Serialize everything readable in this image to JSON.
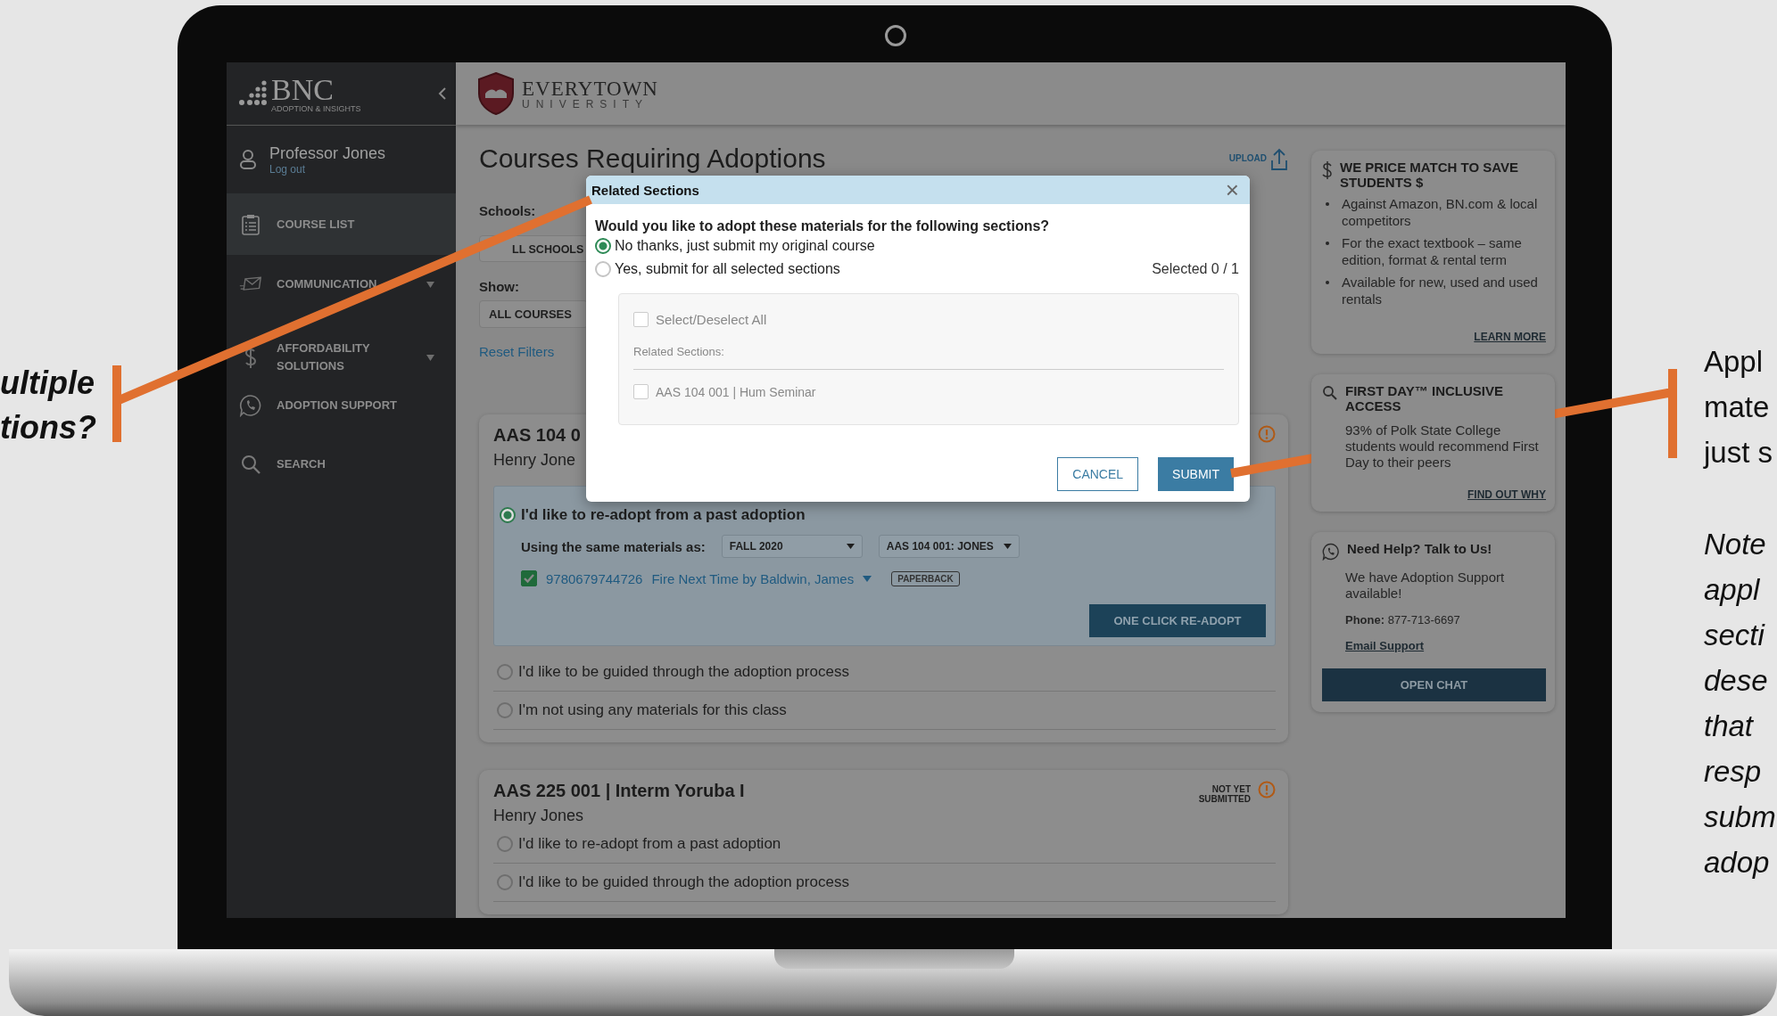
{
  "annotations": {
    "left_lines": [
      "ultiple",
      "tions?"
    ],
    "right_lines": [
      "Appl",
      "mate",
      "just s"
    ],
    "note_lines": [
      "Note",
      "appl",
      "secti",
      "dese",
      "that",
      "resp",
      "subm",
      "adop"
    ]
  },
  "sidebar": {
    "logo": "BNC",
    "logo_sub": "ADOPTION & INSIGHTS",
    "user": {
      "name": "Professor Jones",
      "link": "Log out"
    },
    "items": [
      {
        "label": "COURSE LIST",
        "selected": true,
        "expandable": false
      },
      {
        "label": "COMMUNICATION",
        "selected": false,
        "expandable": true
      },
      {
        "label": "AFFORDABILITY SOLUTIONS",
        "selected": false,
        "expandable": true
      },
      {
        "label": "ADOPTION SUPPORT",
        "selected": false,
        "expandable": false
      },
      {
        "label": "SEARCH",
        "selected": false,
        "expandable": false
      }
    ]
  },
  "header": {
    "school": "EVERYTOWN",
    "school_sub": "UNIVERSITY"
  },
  "page": {
    "title": "Courses Requiring Adoptions",
    "upload": "UPLOAD",
    "filters": [
      {
        "label": "Schools:",
        "value": "LL SCHOOLS"
      },
      {
        "label": "Show:",
        "value": "ALL COURSES"
      }
    ],
    "reset": "Reset Filters",
    "courses": [
      {
        "title": "AAS 104 0",
        "instructor": "Henry Jone",
        "options": [
          {
            "label": "I'd like to re-adopt from a past adoption",
            "selected": true,
            "details": {
              "materials_label": "Using the same materials as:",
              "term": "FALL 2020",
              "section": "AAS 104 001: JONES",
              "items": [
                {
                  "checked": true,
                  "isbn": "9780679744726",
                  "title": "Fire Next Time by Baldwin, James",
                  "format": "PAPERBACK"
                }
              ],
              "button": "ONE CLICK RE-ADOPT"
            }
          },
          {
            "label": "I'd like to be guided through the adoption process",
            "selected": false
          },
          {
            "label": "I'm not using any materials for this class",
            "selected": false
          }
        ]
      },
      {
        "title": "AAS 225 001 | Interm Yoruba I",
        "status": "NOT YET SUBMITTED",
        "instructor": "Henry Jones",
        "options": [
          {
            "label": "I'd like to re-adopt from a past adoption",
            "selected": false
          },
          {
            "label": "I'd like to be guided through the adoption process",
            "selected": false
          }
        ]
      }
    ]
  },
  "aside": [
    {
      "kind": "list",
      "title": "WE PRICE MATCH TO SAVE STUDENTS $",
      "bullets": [
        "Against Amazon, BN.com & local competitors",
        "For the exact textbook – same edition, format & rental term",
        "Available for new, used and used rentals"
      ],
      "link": "LEARN MORE"
    },
    {
      "kind": "text",
      "title": "FIRST DAY™ INCLUSIVE ACCESS",
      "text": "93% of Polk State College students would recommend First Day to their peers",
      "link": "FIND OUT WHY"
    },
    {
      "kind": "contact",
      "title": "Need Help? Talk to Us!",
      "text": "We have Adoption Support available!",
      "phone": "**Phone:** 877-713-6697",
      "link": "Email Support",
      "button": "OPEN CHAT"
    }
  ],
  "modal": {
    "title": "Related Sections",
    "close": "×",
    "question": "Would you like to adopt these materials for the following sections?",
    "choices": [
      {
        "label": "No thanks, just submit my original course",
        "selected": true
      },
      {
        "label": "Yes, submit for all selected sections",
        "selected": false
      }
    ],
    "selected_count": "Selected 0 / 1",
    "select_all": {
      "label": "Select/Deselect All",
      "checked": false
    },
    "list_label": "Related Sections:",
    "sections": [
      {
        "label": "AAS 104 001 | Hum Seminar",
        "checked": false
      }
    ],
    "cancel": "CANCEL",
    "submit": "SUBMIT"
  }
}
